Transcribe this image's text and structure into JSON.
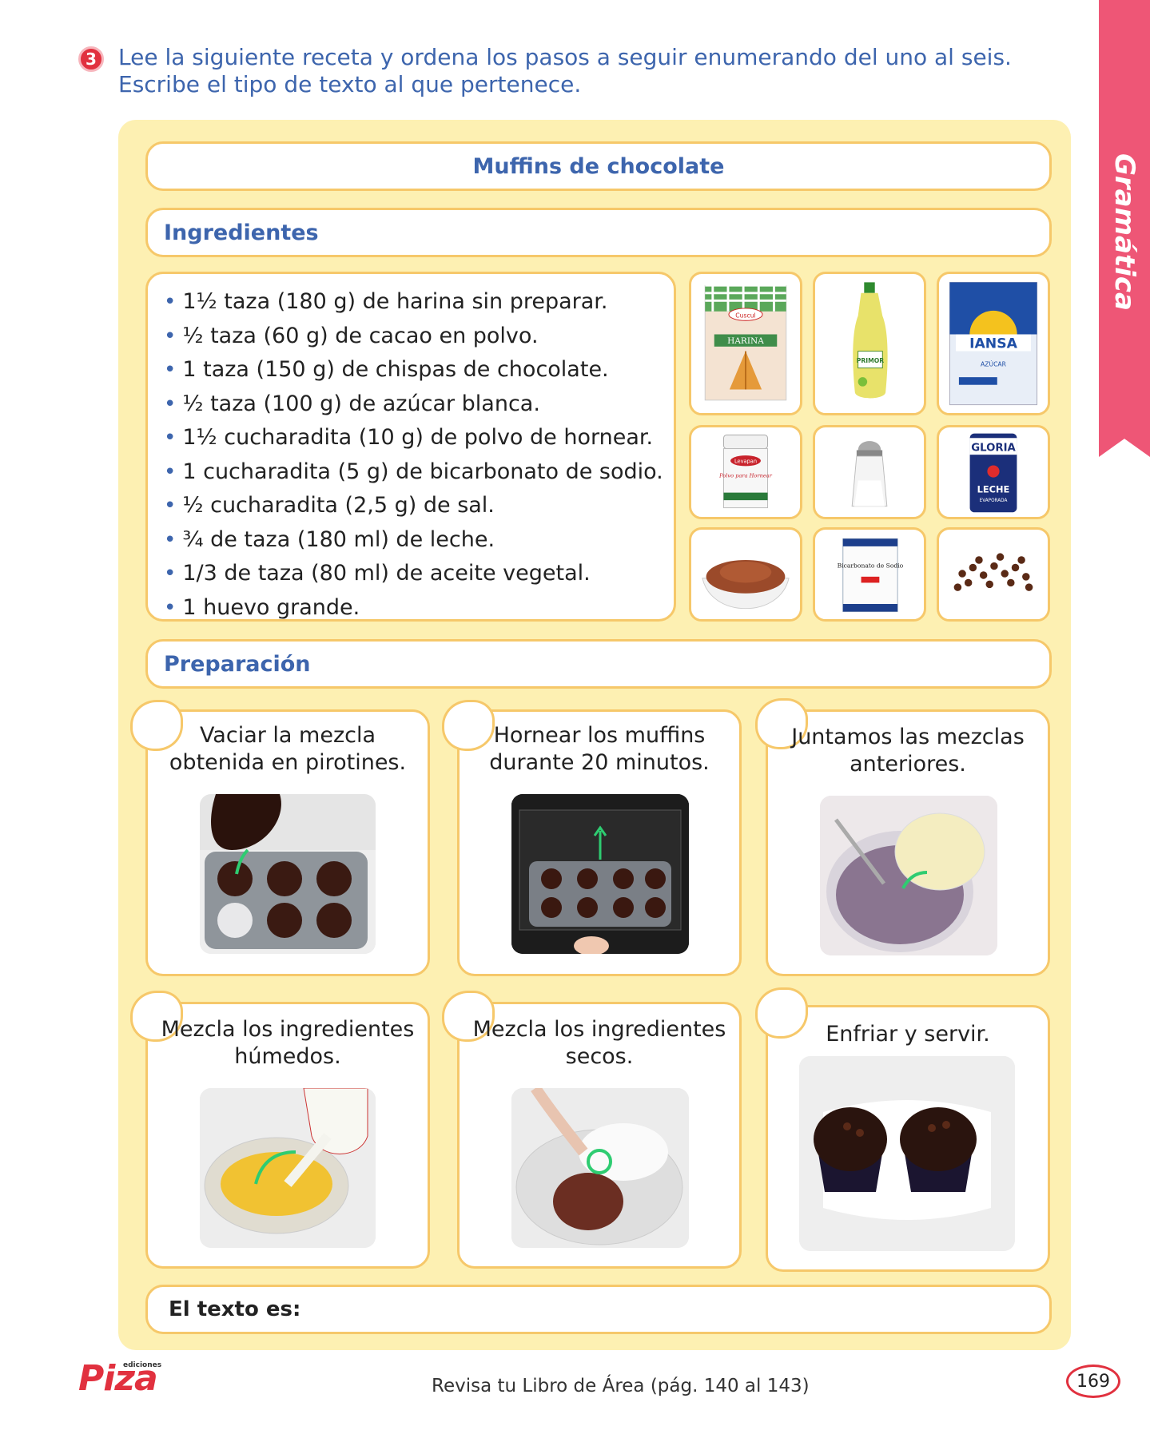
{
  "side_tab": {
    "label": "Gramática"
  },
  "task": {
    "number": "3",
    "instruction": "Lee la siguiente receta y ordena los pasos a seguir enumerando del uno al seis. Escribe el tipo de texto al que pertenece."
  },
  "recipe": {
    "title": "Muffins de chocolate",
    "ingredients_heading": "Ingredientes",
    "ingredients": [
      "1½ taza (180 g) de harina sin preparar.",
      "½ taza (60 g) de cacao en polvo.",
      "1 taza (150 g) de chispas de chocolate.",
      "½ taza (100 g) de azúcar blanca.",
      "1½ cucharadita (10 g) de polvo de hornear.",
      "1 cucharadita (5 g) de bicarbonato de sodio.",
      "½ cucharadita (2,5 g) de sal.",
      "¾ de taza (180 ml) de leche.",
      "1/3 de taza (80 ml) de aceite vegetal.",
      "1 huevo grande."
    ],
    "product_labels": {
      "harina_brand": "Cuscul",
      "harina": "HARINA",
      "aceite": "PRIMOR",
      "azucar_brand": "IANSA",
      "azucar": "AZÚCAR",
      "polvo_brand": "Levapan",
      "polvo": "Polvo para Hornear",
      "leche_brand": "GLORIA",
      "leche": "LECHE",
      "leche_sub": "EVAPORADA",
      "bicarbonato": "Bicarbonato de Sodio"
    },
    "preparation_heading": "Preparación",
    "steps": [
      "Vaciar la mezcla obtenida en pirotines.",
      "Hornear los muffins durante 20 minutos.",
      "Juntamos las mezclas anteriores.",
      "Mezcla los ingredientes húmedos.",
      "Mezcla los ingredientes secos.",
      "Enfriar y servir."
    ],
    "final_prompt": "El texto es:"
  },
  "footer": {
    "logo_small": "ediciones",
    "logo": "Piza",
    "reference": "Revisa tu Libro de Área (pág. 140 al 143)",
    "page": "169"
  },
  "colors": {
    "accent_blue": "#3d65ad",
    "panel_yellow": "#fdf0b2",
    "border_gold": "#f6c86a",
    "tab_pink": "#ee5676",
    "red": "#e1313f"
  }
}
